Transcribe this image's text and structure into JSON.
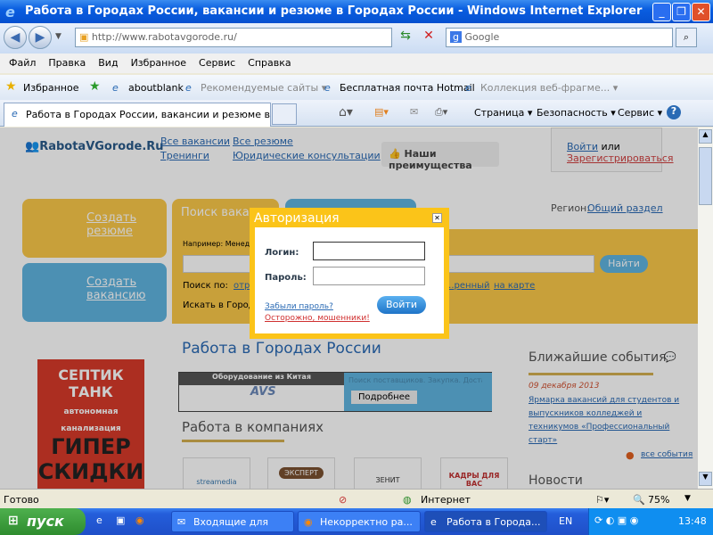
{
  "window": {
    "title": "Работа в Городах России, вакансии и резюме в Городах России - Windows Internet Explorer"
  },
  "nav": {
    "url": "http://www.rabotavgorode.ru/",
    "search_placeholder": "Google"
  },
  "menu": [
    "Файл",
    "Правка",
    "Вид",
    "Избранное",
    "Сервис",
    "Справка"
  ],
  "favorites": {
    "label": "Избранное",
    "items": [
      "aboutblank",
      "Рекомендуемые сайты ▾",
      "Бесплатная почта Hotmail",
      "Коллекция веб-фрагме... ▾"
    ]
  },
  "tab": {
    "title": "Работа в Городах России, вакансии и резюме в Го..."
  },
  "commandbar": [
    "Страница ▾",
    "Безопасность ▾",
    "Сервис ▾"
  ],
  "site": {
    "logo": "RabotaVGorode.Ru",
    "links": [
      "Все вакансии",
      "Все резюме",
      "Тренинги",
      "Юридические консультации"
    ],
    "advantages": "Наши преимущества",
    "login": "Войти",
    "or": "или",
    "register": "Зарегистрироваться",
    "create_resume": "Создать резюме",
    "create_vacancy": "Создать вакансию",
    "search_tab": "Поиск вакан...",
    "region_label": "Регион:",
    "region": "Общий раздел",
    "example": "Например: Менеджер",
    "find": "Найти",
    "search_by": "Поиск по:",
    "search_opt1": "отр...",
    "search_adv": "...ренный",
    "search_map": "на карте",
    "search_in": "Искать в Город...",
    "heading": "Работа в Городах России",
    "ad": {
      "title": "Оборудование из Китая",
      "brand": "AVS",
      "text": "Поиск поставщиков. Закупка. Доставка",
      "more": "Подробнее"
    },
    "companies_heading": "Работа в компаниях",
    "companies": [
      "streamedia",
      "ЭКСПЕРТ",
      "ЗЕНИТ",
      "КАДРЫ ДЛЯ ВАС"
    ],
    "events_heading": "Ближайшие события",
    "event_date": "09 декабря 2013",
    "event_text": "Ярмарка вакансий для студентов и выпускников колледжей и техникумов «Профессиональный старт»",
    "all_events": "все события",
    "news_heading": "Новости"
  },
  "modal": {
    "title": "Авторизация",
    "login_label": "Логин:",
    "password_label": "Пароль:",
    "login_value": "",
    "password_value": "",
    "forgot": "Забыли пароль?",
    "fraud": "Осторожно, мошенники!",
    "submit": "Войти"
  },
  "status": {
    "text": "Готово",
    "zone": "Интернет",
    "zoom": "75%"
  },
  "taskbar": {
    "start": "пуск",
    "tasks": [
      "Входящие для",
      "Некорректно ра...",
      "Работа в Города..."
    ],
    "lang": "EN",
    "clock": "13:48"
  }
}
